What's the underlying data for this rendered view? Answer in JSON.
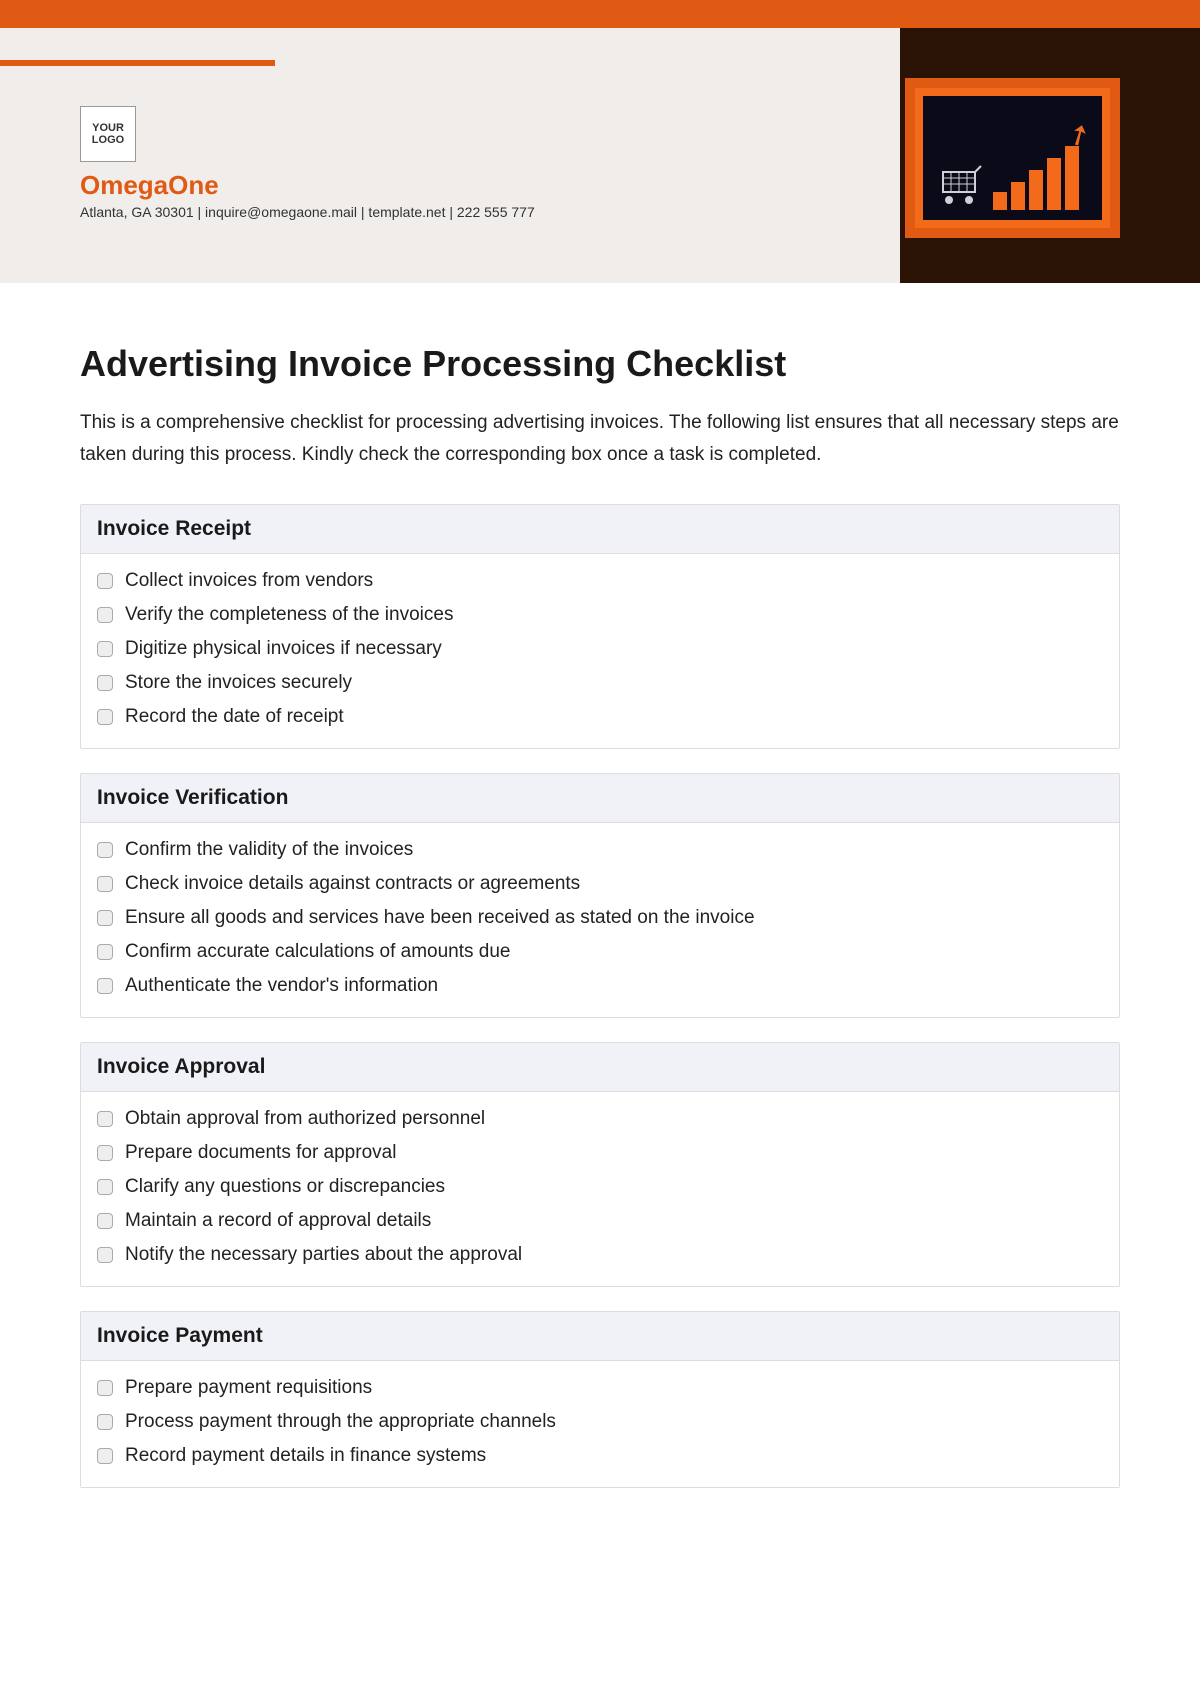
{
  "header": {
    "logo_text": "YOUR LOGO",
    "company_name": "OmegaOne",
    "contact_line": "Atlanta, GA 30301 | inquire@omegaone.mail | template.net | 222 555 777"
  },
  "document": {
    "title": "Advertising Invoice Processing Checklist",
    "intro": "This is a comprehensive checklist for processing advertising invoices. The following list ensures that all necessary steps are taken during this process. Kindly check the corresponding box once a task is completed."
  },
  "sections": [
    {
      "title": "Invoice Receipt",
      "items": [
        "Collect invoices from vendors",
        "Verify the completeness of the invoices",
        "Digitize physical invoices if necessary",
        "Store the invoices securely",
        "Record the date of receipt"
      ]
    },
    {
      "title": "Invoice Verification",
      "items": [
        "Confirm the validity of the invoices",
        "Check invoice details against contracts or agreements",
        "Ensure all goods and services have been received as stated on the invoice",
        "Confirm accurate calculations of amounts due",
        "Authenticate the vendor's information"
      ]
    },
    {
      "title": "Invoice Approval",
      "items": [
        "Obtain approval from authorized personnel",
        "Prepare documents for approval",
        "Clarify any questions or discrepancies",
        "Maintain a record of approval details",
        "Notify the necessary parties about the approval"
      ]
    },
    {
      "title": "Invoice Payment",
      "items": [
        "Prepare payment requisitions",
        "Process payment through the appropriate channels",
        "Record payment details in finance systems"
      ]
    }
  ]
}
